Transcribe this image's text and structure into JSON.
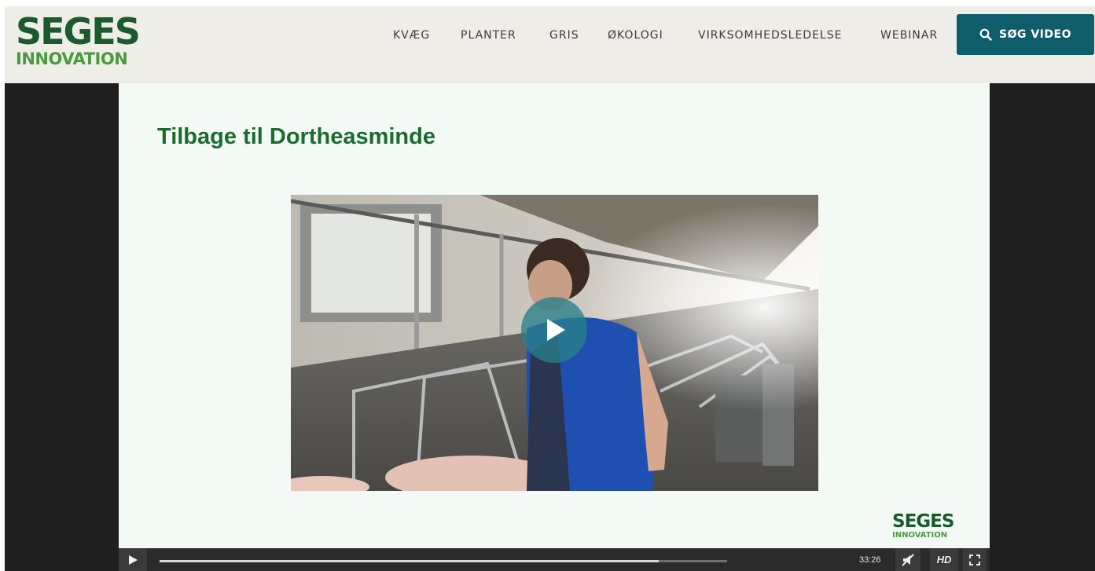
{
  "logo": {
    "main": "SEGES",
    "sub": "INNOVATION"
  },
  "nav": {
    "items": [
      "KVÆG",
      "PLANTER",
      "GRIS",
      "ØKOLOGI",
      "VIRKSOMHEDSLEDELSE",
      "WEBINAR"
    ]
  },
  "search": {
    "label": "SØG VIDEO",
    "icon": "search-icon"
  },
  "slide": {
    "title": "Tilbage til Dortheasminde",
    "thumbnail_logo": "SEGES",
    "logo_main": "SEGES",
    "logo_sub": "INNOVATION"
  },
  "player": {
    "duration": "33:26",
    "progress": 0.88,
    "hd_label": "HD",
    "icons": [
      "play-icon",
      "mute-icon",
      "hd-icon",
      "fullscreen-icon"
    ]
  },
  "colors": {
    "brand_green": "#1b5b2b",
    "brand_light_green": "#4b9a3f",
    "search_button": "#0f5c6a",
    "header_bg": "#efede8",
    "slide_title": "#1b6b2e",
    "play_overlay": "#28808a"
  }
}
